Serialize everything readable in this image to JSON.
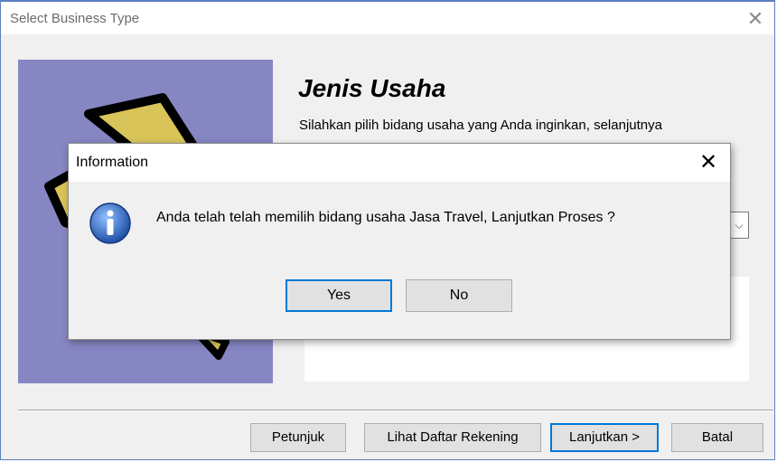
{
  "window": {
    "title": "Select Business Type",
    "close_glyph": "✕"
  },
  "page": {
    "heading": "Jenis Usaha",
    "description": "Silahkan pilih bidang usaha yang Anda inginkan, selanjutnya"
  },
  "buttons": {
    "petunjuk": "Petunjuk",
    "lihat_daftar_rekening": "Lihat Daftar Rekening",
    "lanjutkan": "Lanjutkan >",
    "batal": "Batal"
  },
  "dialog": {
    "title": "Information",
    "close_glyph": "✕",
    "message": "Anda telah telah memilih bidang usaha Jasa Travel, Lanjutkan Proses ?",
    "yes_label": "Yes",
    "no_label": "No",
    "icon": "info-icon"
  },
  "colors": {
    "accent": "#0078d7",
    "side_panel": "#8686c3",
    "window_border": "#5a7fc1",
    "info_icon": "#2a5fb8"
  }
}
